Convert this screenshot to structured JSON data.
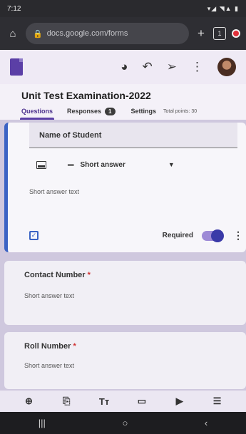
{
  "status": {
    "time": "7:12",
    "icons": "▾◢ ◥▲ ▮"
  },
  "browser": {
    "home_icon": "home-icon",
    "url": "docs.google.com/forms",
    "tab_count": "1",
    "plus": "+"
  },
  "header": {
    "app": "Google Forms",
    "icons": [
      "palette-icon",
      "undo-icon",
      "send-icon",
      "more-icon"
    ]
  },
  "form": {
    "title": "Unit Test Examination-2022",
    "tabs": [
      {
        "label": "Questions"
      },
      {
        "label": "Responses",
        "badge": "1"
      },
      {
        "label": "Settings"
      }
    ],
    "points": "Total points: 30"
  },
  "q1": {
    "title": "Name of Student",
    "type": "Short answer",
    "hint": "Short answer text",
    "required_label": "Required",
    "required": true
  },
  "q2": {
    "title": "Contact Number",
    "star": "*",
    "hint": "Short answer text"
  },
  "q3": {
    "title": "Roll Number",
    "star": "*",
    "hint": "Short answer text"
  },
  "toolbar": [
    "add-question-icon",
    "import-questions-icon",
    "title-text-icon",
    "image-icon",
    "video-icon",
    "section-icon"
  ],
  "colors": {
    "accent": "#5b3fa6",
    "active_card": "#3b63c4",
    "toggle": "#3a3aa8"
  }
}
